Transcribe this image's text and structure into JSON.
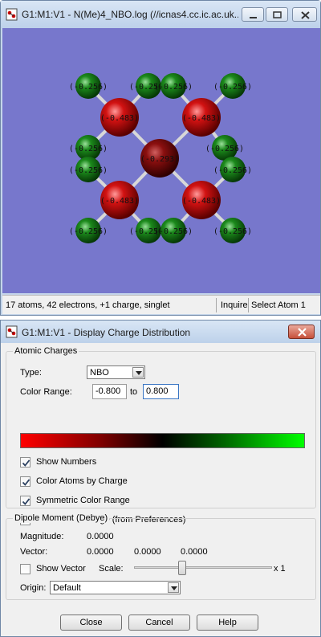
{
  "viewer": {
    "title": "G1:M1:V1 - N(Me)4_NBO.log (//icnas4.cc.ic.ac.uk...",
    "atoms": [
      {
        "element": "C",
        "charge": "(-0.256)"
      },
      {
        "element": "C",
        "charge": "(-0.256)"
      },
      {
        "element": "C",
        "charge": "(-0.256)"
      },
      {
        "element": "C",
        "charge": "(-0.256)"
      },
      {
        "element": "C",
        "charge": "(-0.256)"
      },
      {
        "element": "C",
        "charge": "(-0.256)"
      },
      {
        "element": "C",
        "charge": "(-0.256)"
      },
      {
        "element": "C",
        "charge": "(-0.256)"
      },
      {
        "element": "C",
        "charge": "(-0.256)"
      },
      {
        "element": "C",
        "charge": "(-0.256)"
      },
      {
        "element": "C",
        "charge": "(-0.256)"
      },
      {
        "element": "C",
        "charge": "(-0.256)"
      },
      {
        "element": "H",
        "charge": "(-0.483)"
      },
      {
        "element": "H",
        "charge": "(-0.483)"
      },
      {
        "element": "H",
        "charge": "(-0.483)"
      },
      {
        "element": "H",
        "charge": "(-0.483)"
      },
      {
        "element": "N",
        "charge": "(-0.293)"
      }
    ],
    "status": {
      "summary": "17 atoms, 42 electrons, +1 charge, singlet",
      "inquire": "Inquire",
      "mode": "Select Atom 1"
    },
    "colors": {
      "background": "#7777cc",
      "positive": "#00ff00",
      "negative": "#ff0000"
    }
  },
  "dialog": {
    "title": "G1:M1:V1 - Display Charge Distribution",
    "atomic_charges": {
      "group_label": "Atomic Charges",
      "type_label": "Type:",
      "type_value": "NBO",
      "color_range_label": "Color Range:",
      "range_min": "-0.800",
      "range_to": "to",
      "range_max": "0.800",
      "checkboxes": [
        {
          "label": "Show Numbers",
          "checked": true
        },
        {
          "label": "Color Atoms by Charge",
          "checked": true
        },
        {
          "label": "Symmetric Color Range",
          "checked": true
        },
        {
          "label": "Fixed Color Range (from Preferences)",
          "checked": false
        }
      ]
    },
    "dipole": {
      "group_label": "Dipole Moment (Debye)",
      "magnitude_label": "Magnitude:",
      "magnitude": "0.0000",
      "vector_label": "Vector:",
      "vector": [
        "0.0000",
        "0.0000",
        "0.0000"
      ],
      "show_vector_label": "Show Vector",
      "show_vector_checked": false,
      "scale_label": "Scale:",
      "scale_value": "x 1",
      "scale_position": 0.35,
      "origin_label": "Origin:",
      "origin_value": "Default"
    },
    "buttons": {
      "close": "Close",
      "cancel": "Cancel",
      "help": "Help"
    }
  }
}
